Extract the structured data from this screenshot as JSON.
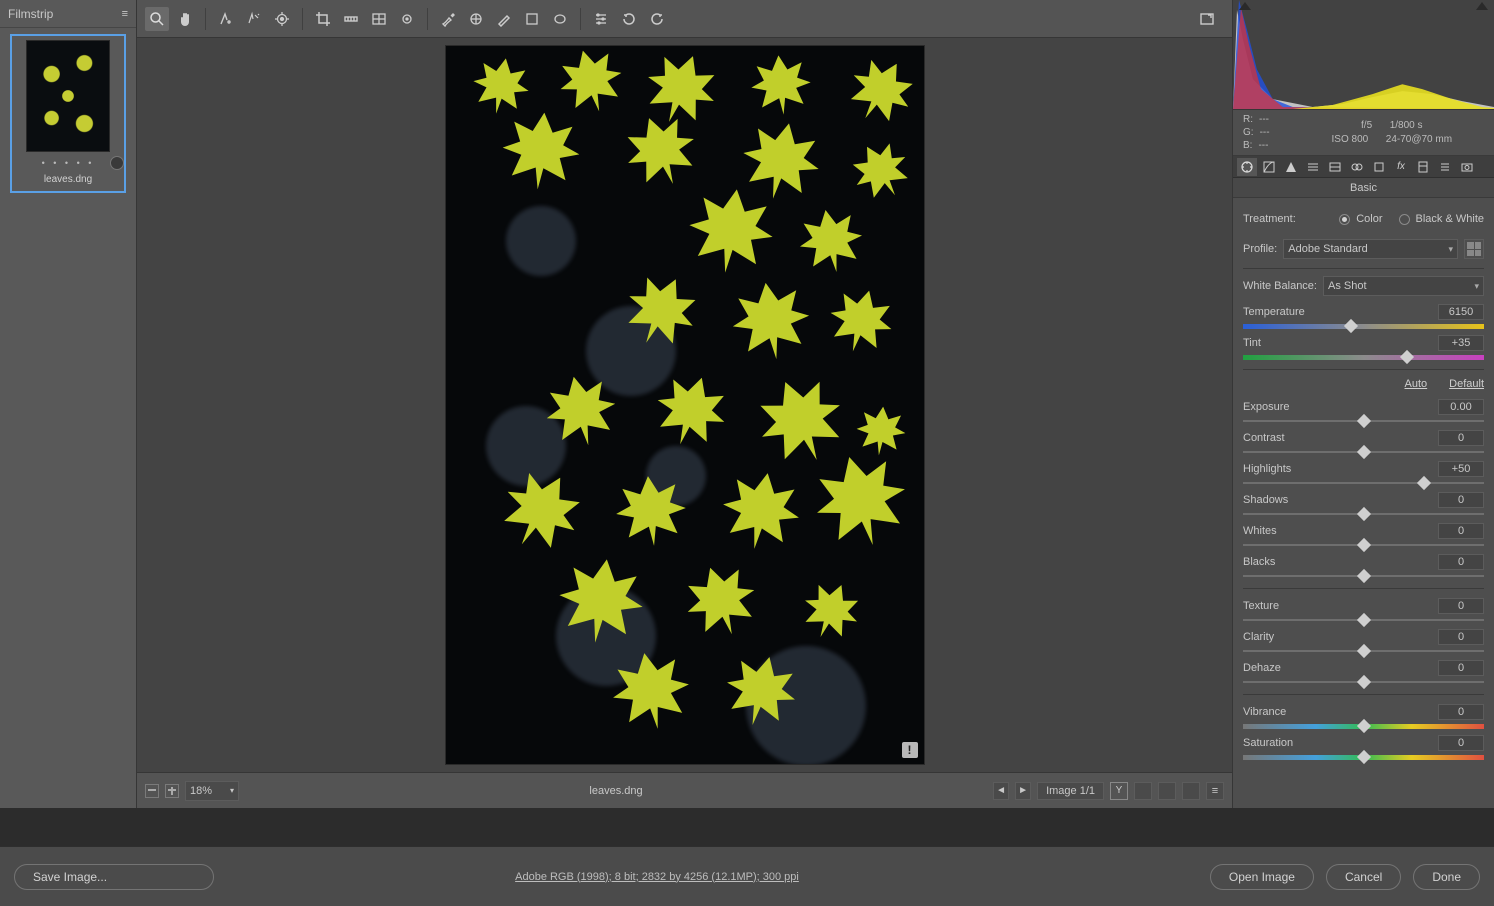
{
  "filmstrip": {
    "title": "Filmstrip",
    "thumb_name": "leaves.dng",
    "dots": "• • • • •"
  },
  "toolbar": {
    "tools": [
      "zoom",
      "hand",
      "white-balance",
      "color-sampler",
      "target-adjust",
      "crop",
      "straighten",
      "spot-removal",
      "redeye",
      "masking",
      "adjustment-brush",
      "graduated-filter",
      "radial-filter",
      "preferences",
      "rotate-ccw",
      "rotate-cw"
    ],
    "fullscreen_tip": "Toggle full screen"
  },
  "footer": {
    "zoom": "18%",
    "filename": "leaves.dng",
    "image_counter": "Image 1/1",
    "compare_label": "Y"
  },
  "rgb": {
    "labels": {
      "r": "R:",
      "g": "G:",
      "b": "B:"
    },
    "values": {
      "r": "---",
      "g": "---",
      "b": "---"
    }
  },
  "exif": {
    "aperture": "f/5",
    "shutter": "1/800 s",
    "iso": "ISO 800",
    "lens": "24-70@70 mm"
  },
  "panel": {
    "title": "Basic",
    "treatment_label": "Treatment:",
    "treatment_color": "Color",
    "treatment_bw": "Black & White",
    "profile_label": "Profile:",
    "profile_value": "Adobe Standard",
    "wb_label": "White Balance:",
    "wb_value": "As Shot",
    "auto": "Auto",
    "default": "Default",
    "sliders": {
      "temperature": {
        "label": "Temperature",
        "value": "6150",
        "pos": 45,
        "gradient": "temp"
      },
      "tint": {
        "label": "Tint",
        "value": "+35",
        "pos": 68,
        "gradient": "tint"
      },
      "exposure": {
        "label": "Exposure",
        "value": "0.00",
        "pos": 50
      },
      "contrast": {
        "label": "Contrast",
        "value": "0",
        "pos": 50
      },
      "highlights": {
        "label": "Highlights",
        "value": "+50",
        "pos": 75
      },
      "shadows": {
        "label": "Shadows",
        "value": "0",
        "pos": 50
      },
      "whites": {
        "label": "Whites",
        "value": "0",
        "pos": 50
      },
      "blacks": {
        "label": "Blacks",
        "value": "0",
        "pos": 50
      },
      "texture": {
        "label": "Texture",
        "value": "0",
        "pos": 50
      },
      "clarity": {
        "label": "Clarity",
        "value": "0",
        "pos": 50
      },
      "dehaze": {
        "label": "Dehaze",
        "value": "0",
        "pos": 50
      },
      "vibrance": {
        "label": "Vibrance",
        "value": "0",
        "pos": 50,
        "gradient": "vib"
      },
      "saturation": {
        "label": "Saturation",
        "value": "0",
        "pos": 50,
        "gradient": "sat"
      }
    }
  },
  "bottom": {
    "save_image": "Save Image...",
    "workflow": "Adobe RGB (1998); 8 bit; 2832 by 4256 (12.1MP); 300 ppi",
    "open": "Open Image",
    "cancel": "Cancel",
    "done": "Done"
  }
}
